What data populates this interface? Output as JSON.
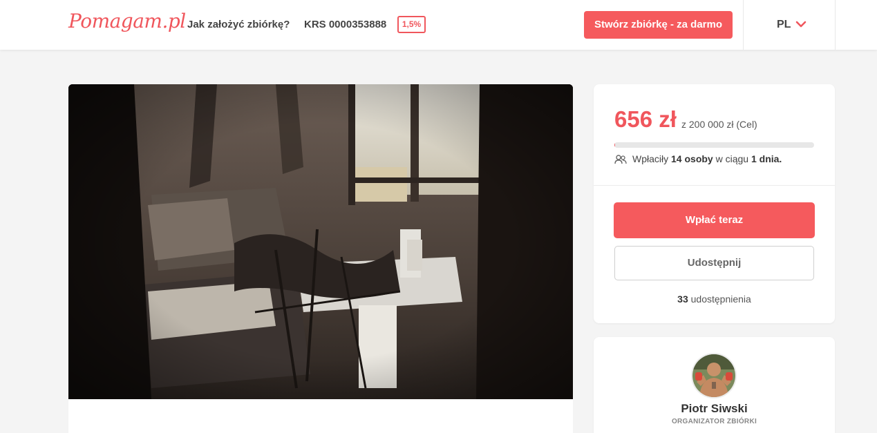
{
  "header": {
    "logo": "Pomagam.pl",
    "how_to_label": "Jak założyć zbiórkę?",
    "krs_label": "KRS 0000353888",
    "krs_badge": "1,5%",
    "create_button": "Stwórz zbiórkę - za darmo",
    "language": "PL",
    "language_icon": "chevron-down-icon"
  },
  "fundraiser": {
    "raised": "656 zł",
    "goal": "z 200 000 zł (Cel)",
    "progress_fraction": 0.00328,
    "donors_prefix": "Wpłaciły",
    "donors_count": "14 osoby",
    "donors_mid": "w ciągu",
    "donors_period": "1 dnia.",
    "donors_icon": "people-icon",
    "pay_button": "Wpłać teraz",
    "share_button": "Udostępnij",
    "share_count": "33",
    "share_suffix": "udostępnienia"
  },
  "organizer": {
    "name": "Piotr Siwski",
    "role": "ORGANIZATOR ZBIÓRKI"
  },
  "colors": {
    "brand": "#f0565c",
    "button": "#f55a5d",
    "background": "#f4f4f4"
  }
}
